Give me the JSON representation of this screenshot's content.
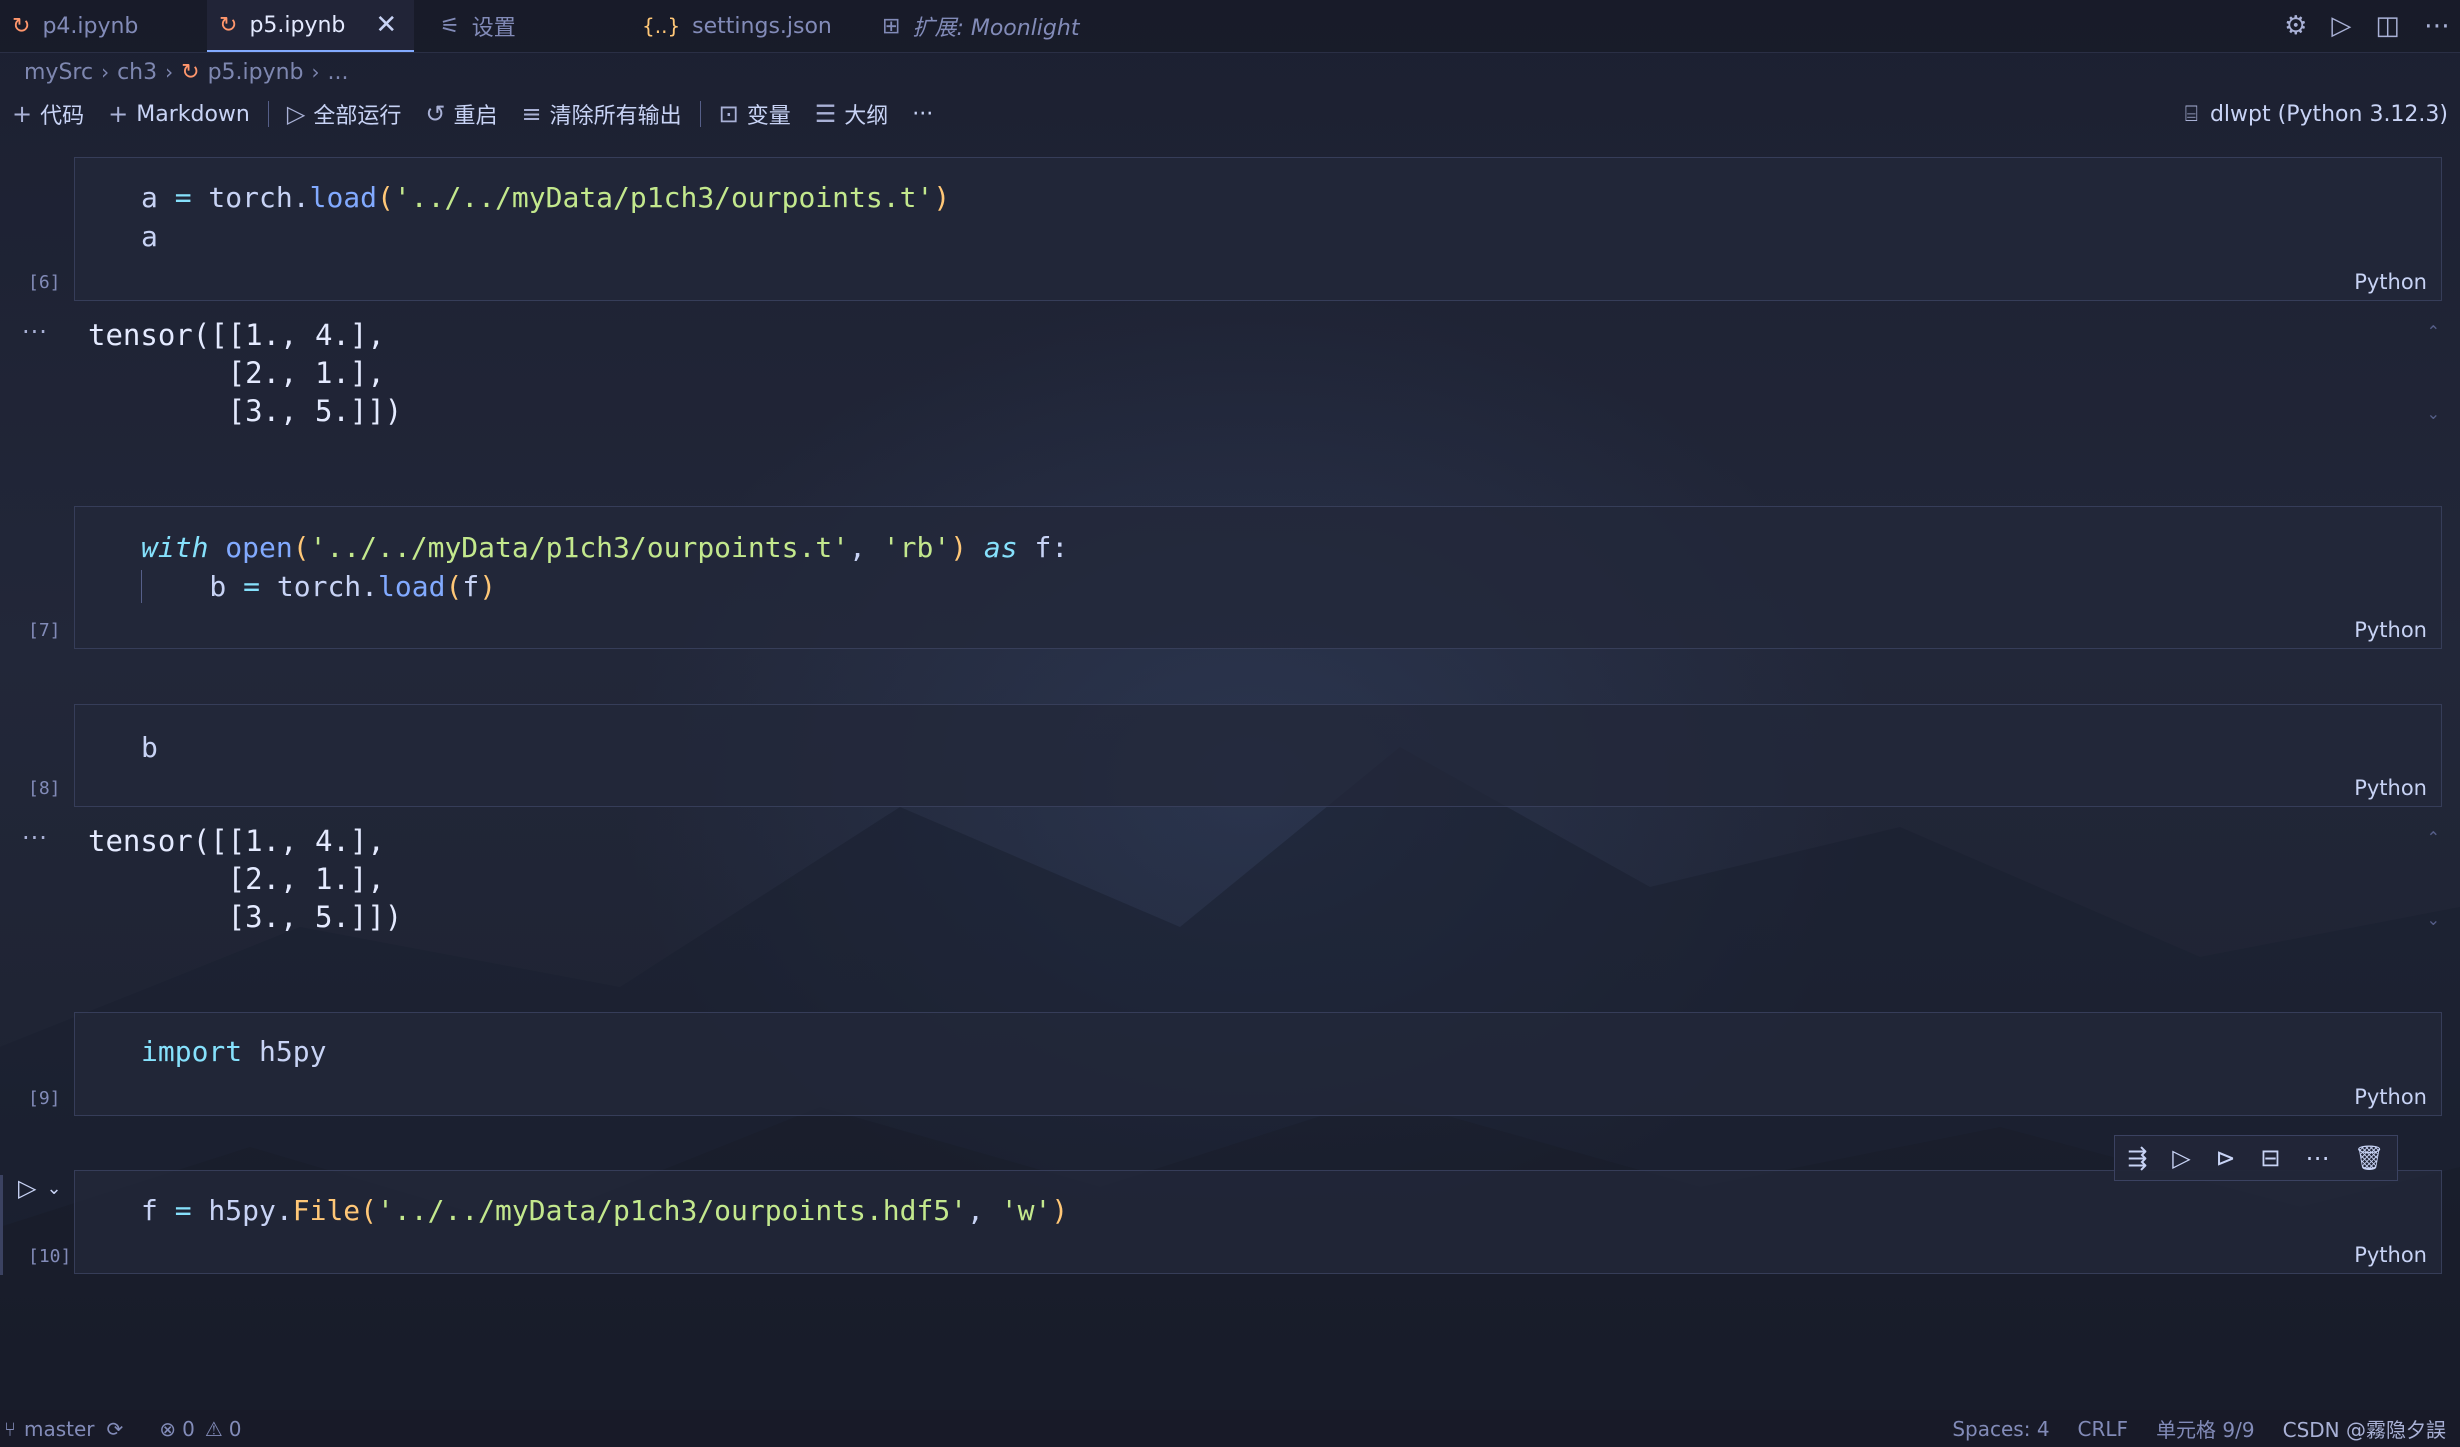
{
  "tabs": [
    {
      "label": "p4.ipynb",
      "icon": "notebook-icon"
    },
    {
      "label": "p5.ipynb",
      "icon": "notebook-icon",
      "active": true
    },
    {
      "label": "设置",
      "icon": "settings-sliders-icon"
    },
    {
      "label": "settings.json",
      "icon": "json-braces-icon"
    },
    {
      "label": "扩展: Moonlight",
      "icon": "extensions-icon"
    }
  ],
  "breadcrumb": [
    "mySrc",
    "ch3",
    "p5.ipynb",
    "..."
  ],
  "toolbar": {
    "code": "代码",
    "markdown": "Markdown",
    "run_all": "全部运行",
    "restart": "重启",
    "clear_outputs": "清除所有输出",
    "variables": "变量",
    "outline": "大纲",
    "more": "···",
    "kernel": "dlwpt (Python 3.12.3)"
  },
  "cells": {
    "c6": {
      "count": "[6]",
      "lang": "Python"
    },
    "c7": {
      "count": "[7]",
      "lang": "Python"
    },
    "c8": {
      "count": "[8]",
      "lang": "Python"
    },
    "c9": {
      "count": "[9]",
      "lang": "Python"
    },
    "c10": {
      "count": "[10]",
      "lang": "Python"
    }
  },
  "outputs": {
    "o6": [
      "tensor([[1., 4.],",
      "        [2., 1.],",
      "        [3., 5.]])"
    ],
    "o8": [
      "tensor([[1., 4.],",
      "        [2., 1.],",
      "        [3., 5.]])"
    ]
  },
  "status": {
    "branch": "master",
    "errors": "0",
    "warnings": "0",
    "spaces": "Spaces: 4",
    "eol": "CRLF",
    "cell": "单元格 9/9",
    "watermark": "CSDN @霧隐夕誤"
  },
  "colors": {
    "background": "#1e2233",
    "accent": "#82aaff",
    "string": "#c3e88d",
    "keyword": "#86e1fc",
    "paren": "#ffc777"
  }
}
